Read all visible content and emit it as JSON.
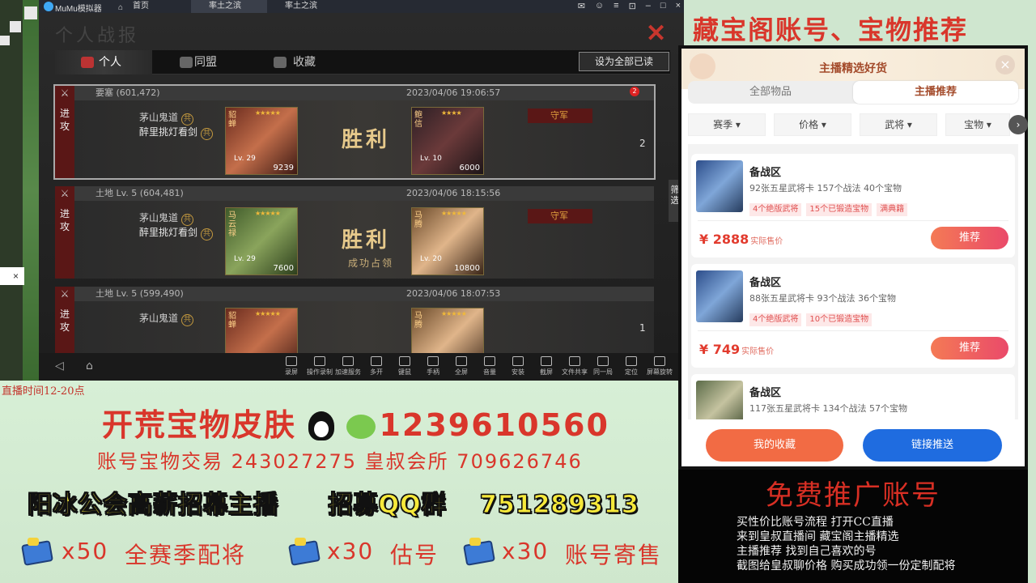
{
  "emulator": {
    "app_name": "MuMu模拟器",
    "home_label": "首页",
    "tabs": [
      "率土之滨",
      "率土之滨"
    ],
    "badge_count": "3"
  },
  "game": {
    "title": "个人战报",
    "tabs": [
      "个人",
      "同盟",
      "收藏"
    ],
    "mark_all_read": "设为全部已读",
    "filter_label": "筛选",
    "reports": [
      {
        "place": "要塞 (601,472)",
        "time": "2023/04/06 19:06:57",
        "action": "进攻",
        "players": [
          "茅山鬼道",
          "醉里挑灯看剑"
        ],
        "player_tags": [
          "共",
          "共"
        ],
        "attacker": {
          "name": "貂蝉",
          "level": "Lv. 29",
          "power": "9239",
          "stars": "★★★★★"
        },
        "result": "胜利",
        "result_sub": "",
        "defender_label": "守军",
        "defender": {
          "name": "鲍信",
          "level": "Lv. 10",
          "power": "6000",
          "stars": "★★★★"
        },
        "count": "2",
        "new_badge": "2"
      },
      {
        "place": "土地 Lv. 5 (604,481)",
        "time": "2023/04/06 18:15:56",
        "action": "进攻",
        "players": [
          "茅山鬼道",
          "醉里挑灯看剑"
        ],
        "player_tags": [
          "共",
          "共"
        ],
        "attacker": {
          "name": "马云禄",
          "level": "Lv. 29",
          "power": "7600",
          "stars": "★★★★★"
        },
        "result": "胜利",
        "result_sub": "成功占领",
        "defender_label": "守军",
        "defender": {
          "name": "马腾",
          "level": "Lv. 20",
          "power": "10800",
          "stars": "★★★★★"
        },
        "count": "",
        "new_badge": ""
      },
      {
        "place": "土地 Lv. 5 (599,490)",
        "time": "2023/04/06 18:07:53",
        "action": "进攻",
        "players": [
          "茅山鬼道"
        ],
        "player_tags": [
          "共"
        ],
        "attacker": {
          "name": "貂蝉",
          "level": "",
          "power": "",
          "stars": "★★★★★"
        },
        "result": "",
        "result_sub": "",
        "defender_label": "守军",
        "defender": {
          "name": "马腾",
          "level": "",
          "power": "",
          "stars": "★★★★★"
        },
        "count": "1",
        "new_badge": ""
      }
    ]
  },
  "toolbar": [
    "录屏",
    "操作录制",
    "加速服务",
    "多开",
    "键鼠",
    "手柄",
    "全屏",
    "音量",
    "安装",
    "截屏",
    "文件共享",
    "同一局",
    "定位",
    "屏幕旋转"
  ],
  "promo": {
    "live_time": "直播时间12-20点",
    "line1": "开荒宝物皮肤",
    "line1_number": "1239610560",
    "line2": "账号宝物交易 243027275  皇叔会所 709626746",
    "line3a": "阳冰公会高薪招幕主播",
    "line3b": "招募QQ群",
    "line3c": "751289313",
    "items": [
      {
        "count": "x50",
        "text": "全赛季配将"
      },
      {
        "count": "x30",
        "text": "估号"
      },
      {
        "count": "x30",
        "text": "账号寄售"
      }
    ]
  },
  "right": {
    "title": "藏宝阁账号、宝物推荐",
    "panel_title": "主播精选好货",
    "seg_tabs": [
      "全部物品",
      "主播推荐"
    ],
    "filters": [
      "赛季",
      "价格",
      "武将",
      "宝物"
    ],
    "items": [
      {
        "name": "备战区",
        "desc": "92张五星武将卡 157个战法 40个宝物",
        "tags": [
          "4个绝版武将",
          "15个已锻造宝物",
          "满典籍"
        ],
        "price": "¥ 2888",
        "price_note": "实际售价",
        "buy": "推荐"
      },
      {
        "name": "备战区",
        "desc": "88张五星武将卡 93个战法 36个宝物",
        "tags": [
          "4个绝版武将",
          "10个已锻造宝物"
        ],
        "price": "¥ 749",
        "price_note": "实际售价",
        "buy": "推荐"
      },
      {
        "name": "备战区",
        "desc": "117张五星武将卡 134个战法 57个宝物",
        "tags": [],
        "price": "",
        "price_note": "",
        "buy": ""
      }
    ],
    "fav_button": "我的收藏",
    "push_button": "链接推送",
    "free_title": "免费推广账号",
    "free_lines": [
      "买性价比账号流程 打开CC直播",
      "来到皇叔直播间  藏宝阁主播精选",
      "主播推荐        找到自己喜欢的号",
      "截图给皇叔聊价格 购买成功领一份定制配将"
    ]
  }
}
